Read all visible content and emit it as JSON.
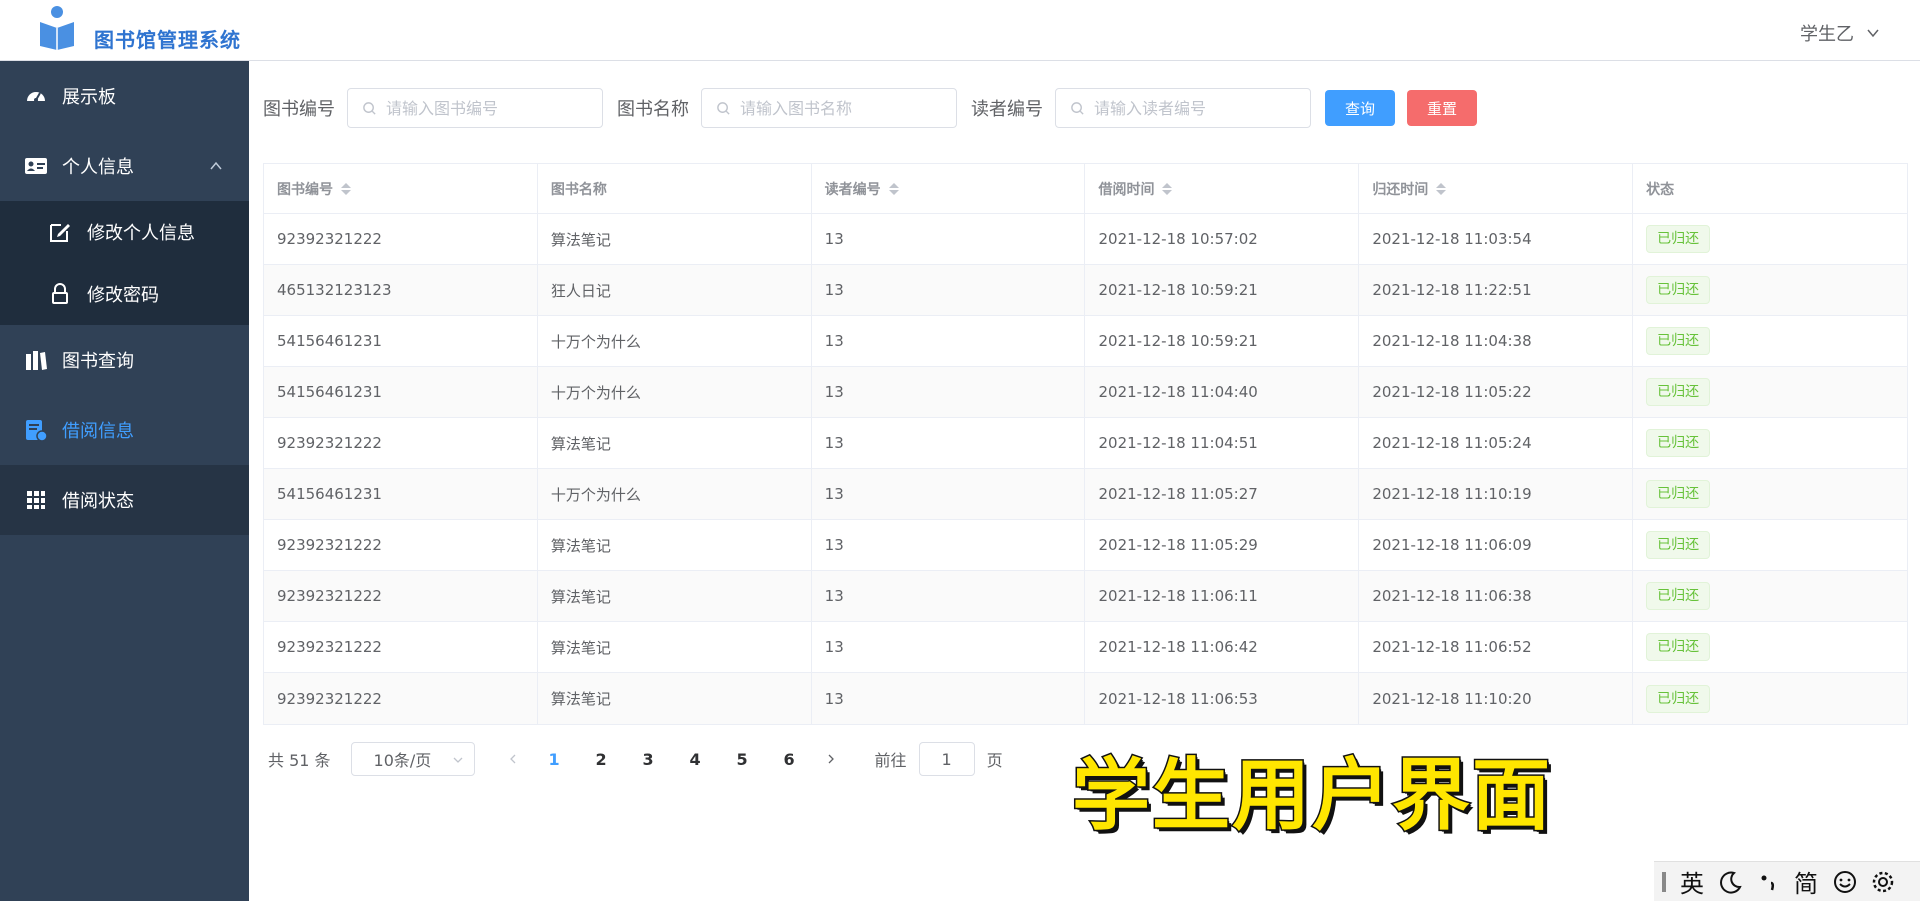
{
  "header": {
    "app_title": "图书馆管理系统",
    "user_name": "学生乙"
  },
  "sidebar": {
    "items": [
      {
        "label": "展示板",
        "icon": "dashboard-icon"
      },
      {
        "label": "个人信息",
        "icon": "id-card-icon",
        "expanded": true
      },
      {
        "label": "修改个人信息",
        "icon": "edit-icon"
      },
      {
        "label": "修改密码",
        "icon": "lock-icon"
      },
      {
        "label": "图书查询",
        "icon": "books-icon"
      },
      {
        "label": "借阅信息",
        "icon": "borrow-record-icon",
        "active": true
      },
      {
        "label": "借阅状态",
        "icon": "grid-icon"
      }
    ]
  },
  "search": {
    "book_id_label": "图书编号",
    "book_id_placeholder": "请输入图书编号",
    "book_name_label": "图书名称",
    "book_name_placeholder": "请输入图书名称",
    "reader_id_label": "读者编号",
    "reader_id_placeholder": "请输入读者编号",
    "query_button": "查询",
    "reset_button": "重置"
  },
  "table": {
    "columns": [
      "图书编号",
      "图书名称",
      "读者编号",
      "借阅时间",
      "归还时间",
      "状态"
    ],
    "rows": [
      [
        "92392321222",
        "算法笔记",
        "13",
        "2021-12-18 10:57:02",
        "2021-12-18 11:03:54",
        "已归还"
      ],
      [
        "465132123123",
        "狂人日记",
        "13",
        "2021-12-18 10:59:21",
        "2021-12-18 11:22:51",
        "已归还"
      ],
      [
        "54156461231",
        "十万个为什么",
        "13",
        "2021-12-18 10:59:21",
        "2021-12-18 11:04:38",
        "已归还"
      ],
      [
        "54156461231",
        "十万个为什么",
        "13",
        "2021-12-18 11:04:40",
        "2021-12-18 11:05:22",
        "已归还"
      ],
      [
        "92392321222",
        "算法笔记",
        "13",
        "2021-12-18 11:04:51",
        "2021-12-18 11:05:24",
        "已归还"
      ],
      [
        "54156461231",
        "十万个为什么",
        "13",
        "2021-12-18 11:05:27",
        "2021-12-18 11:10:19",
        "已归还"
      ],
      [
        "92392321222",
        "算法笔记",
        "13",
        "2021-12-18 11:05:29",
        "2021-12-18 11:06:09",
        "已归还"
      ],
      [
        "92392321222",
        "算法笔记",
        "13",
        "2021-12-18 11:06:11",
        "2021-12-18 11:06:38",
        "已归还"
      ],
      [
        "92392321222",
        "算法笔记",
        "13",
        "2021-12-18 11:06:42",
        "2021-12-18 11:06:52",
        "已归还"
      ],
      [
        "92392321222",
        "算法笔记",
        "13",
        "2021-12-18 11:06:53",
        "2021-12-18 11:10:20",
        "已归还"
      ]
    ]
  },
  "pagination": {
    "total_text": "共 51 条",
    "page_size": "10条/页",
    "pages": [
      "1",
      "2",
      "3",
      "4",
      "5",
      "6"
    ],
    "current_page": "1",
    "goto_label": "前往",
    "goto_value": "1",
    "page_suffix": "页"
  },
  "overlay": {
    "caption": "学生用户界面"
  },
  "ime": {
    "lang": "英",
    "mode": "简"
  },
  "colors": {
    "sidebar_bg": "#304156",
    "primary": "#409eff",
    "danger": "#f56c6c",
    "success": "#67c23a"
  }
}
